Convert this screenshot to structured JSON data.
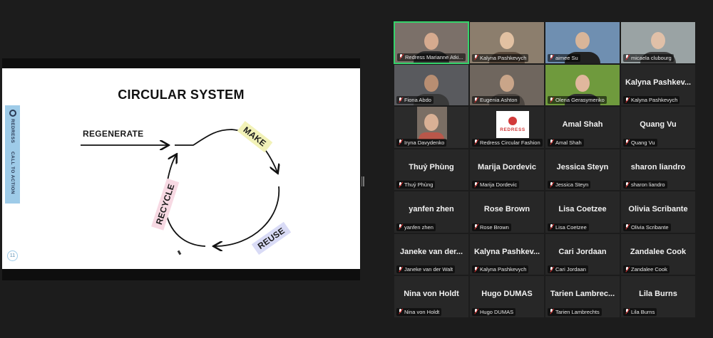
{
  "slide": {
    "title": "CIRCULAR SYSTEM",
    "brand": "REDRESS",
    "call_to_action": "CALL TO ACTION",
    "page_number": "11",
    "labels": {
      "regenerate": "REGENERATE",
      "make": "MAKE",
      "reuse": "REUSE",
      "recycle": "RECYCLE"
    }
  },
  "gallery": {
    "row1": [
      {
        "caption": "Redress Marianne Atki..."
      },
      {
        "caption": "Kalyna Pashkevych"
      },
      {
        "caption": "aimee Su"
      },
      {
        "caption": "micaela clubourg"
      }
    ],
    "row2": [
      {
        "caption": "Fiona Abdo"
      },
      {
        "caption": "Eugenia Ashton"
      },
      {
        "caption": "Olena Gerasymenko"
      },
      {
        "name": "Kalyna  Pashkev...",
        "caption": "Kalyna Pashkevych"
      }
    ],
    "row3": [
      {
        "caption": "Iryna Davydenko"
      },
      {
        "logo": "REDRESS",
        "caption": "Redress Circular Fashion"
      },
      {
        "name": "Amal Shah",
        "caption": "Amal Shah"
      },
      {
        "name": "Quang Vu",
        "caption": "Quang Vu"
      }
    ],
    "row4": [
      {
        "name": "Thuỷ Phùng",
        "caption": "Thuỷ Phùng"
      },
      {
        "name": "Marija Dordevic",
        "caption": "Marija Dordevic"
      },
      {
        "name": "Jessica Steyn",
        "caption": "Jessica Steyn"
      },
      {
        "name": "sharon liandro",
        "caption": "sharon liandro"
      }
    ],
    "row5": [
      {
        "name": "yanfen zhen",
        "caption": "yanfen zhen"
      },
      {
        "name": "Rose Brown",
        "caption": "Rose Brown"
      },
      {
        "name": "Lisa Coetzee",
        "caption": "Lisa Coetzee"
      },
      {
        "name": "Olivia Scribante",
        "caption": "Olivia Scribante"
      }
    ],
    "row6": [
      {
        "name": "Janeke van der...",
        "caption": "Janeke van der Walt"
      },
      {
        "name": "Kalyna  Pashkev...",
        "caption": "Kalyna Pashkevych"
      },
      {
        "name": "Cari Jordaan",
        "caption": "Cari Jordaan"
      },
      {
        "name": "Zandalee Cook",
        "caption": "Zandalee Cook"
      }
    ],
    "row7": [
      {
        "name": "Nina von Holdt",
        "caption": "Nina von Holdt"
      },
      {
        "name": "Hugo DUMAS",
        "caption": "Hugo DUMAS"
      },
      {
        "name": "Tarien  Lambrec...",
        "caption": "Tarien Lambrechts"
      },
      {
        "name": "Lila Burns",
        "caption": "Lila Burns"
      }
    ]
  },
  "colors": {
    "active_speaker_border": "#35d36b",
    "muted_mic": "#e02828",
    "make_highlight": "#f2f2b8",
    "recycle_highlight": "#f7d9e3",
    "reuse_highlight": "#d9dbf6",
    "brand_tab": "#9ecbe8"
  }
}
